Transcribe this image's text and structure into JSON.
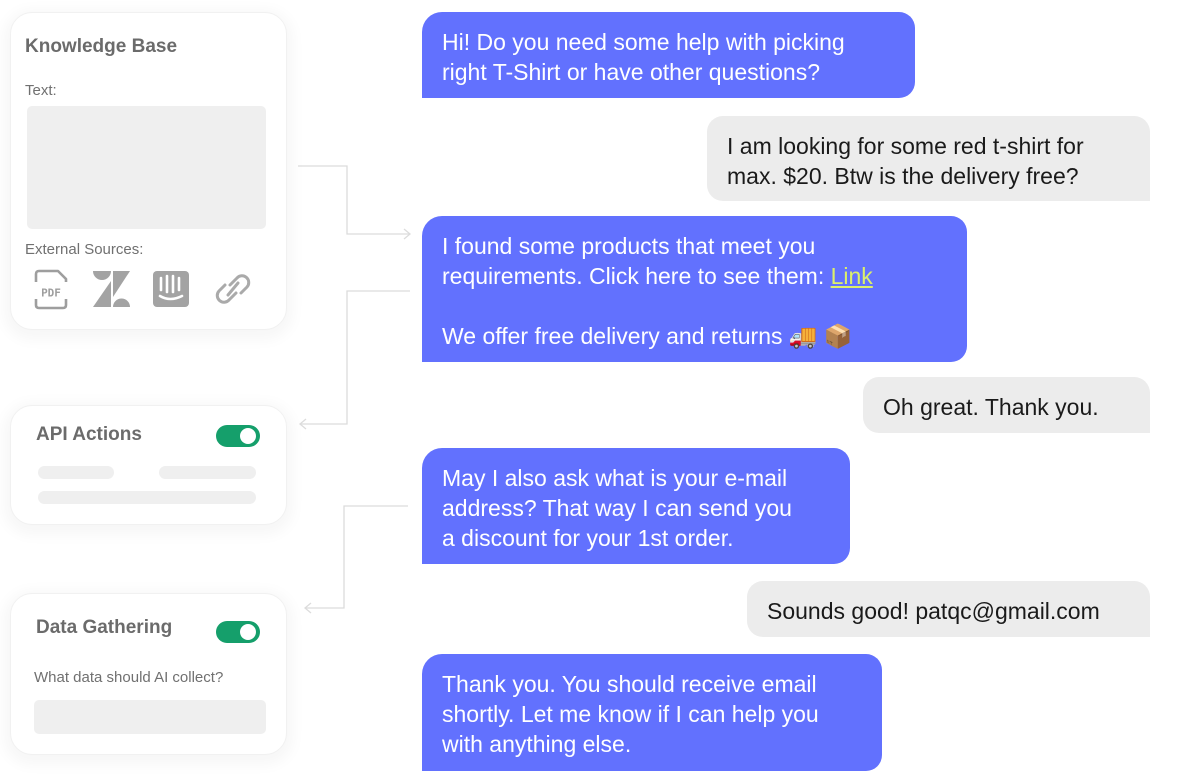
{
  "knowledge_base": {
    "title": "Knowledge Base",
    "text_label": "Text:",
    "text_value": "",
    "external_sources_label": "External Sources:",
    "sources": [
      {
        "icon": "pdf-icon",
        "label": "PDF"
      },
      {
        "icon": "zendesk-icon",
        "label": "Zendesk"
      },
      {
        "icon": "intercom-icon",
        "label": "Intercom"
      },
      {
        "icon": "link-icon",
        "label": "Link"
      }
    ]
  },
  "api_actions": {
    "title": "API Actions",
    "enabled": true
  },
  "data_gathering": {
    "title": "Data Gathering",
    "enabled": true,
    "question_label": "What data should AI collect?",
    "input_value": ""
  },
  "colors": {
    "bot_bubble": "#6271fe",
    "user_bubble": "#ececec",
    "toggle_on": "#159f6b",
    "link": "#dcf06a"
  },
  "chat": {
    "messages": [
      {
        "sender": "bot",
        "lines": [
          "Hi! Do you need some help with picking",
          "right T-Shirt or have other questions?"
        ]
      },
      {
        "sender": "user",
        "lines": [
          "I am looking for some red t-shirt for",
          "max. $20. Btw is the delivery free?"
        ]
      },
      {
        "sender": "bot",
        "line1": "I found some products that meet you",
        "line2_prefix": "requirements. Click here to see them: ",
        "link_text": "Link",
        "line3": "We offer free delivery and returns 🚚 📦"
      },
      {
        "sender": "user",
        "lines": [
          "Oh great. Thank you."
        ]
      },
      {
        "sender": "bot",
        "lines": [
          "May I also ask what is your e-mail",
          "address? That way I can send you",
          "a discount for your 1st order."
        ]
      },
      {
        "sender": "user",
        "lines": [
          "Sounds good! patqc@gmail.com"
        ]
      },
      {
        "sender": "bot",
        "lines": [
          "Thank you. You should receive email",
          "shortly. Let me know if I can help you",
          "with anything else."
        ]
      }
    ]
  }
}
